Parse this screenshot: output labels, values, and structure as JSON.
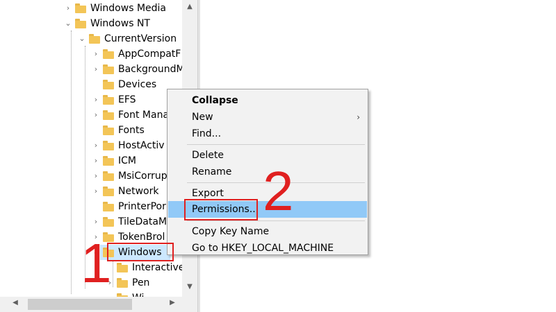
{
  "tree": {
    "nodes": [
      {
        "label": "Windows Media",
        "expander": "›"
      },
      {
        "label": "Windows NT",
        "expander": "⌄"
      },
      {
        "label": "CurrentVersion",
        "expander": "⌄"
      },
      {
        "label": "AppCompatF",
        "expander": "›"
      },
      {
        "label": "BackgroundM",
        "expander": "›"
      },
      {
        "label": "Devices",
        "expander": ""
      },
      {
        "label": "EFS",
        "expander": "›"
      },
      {
        "label": "Font Mana",
        "expander": "›"
      },
      {
        "label": "Fonts",
        "expander": ""
      },
      {
        "label": "HostActiv",
        "expander": "›"
      },
      {
        "label": "ICM",
        "expander": "›"
      },
      {
        "label": "MsiCorrup",
        "expander": "›"
      },
      {
        "label": "Network",
        "expander": "›"
      },
      {
        "label": "PrinterPor",
        "expander": ""
      },
      {
        "label": "TileDataM",
        "expander": "›"
      },
      {
        "label": "TokenBrol",
        "expander": "›"
      },
      {
        "label": "Windows",
        "expander": "⌄"
      },
      {
        "label": "Interactive",
        "expander": ""
      },
      {
        "label": "Pen",
        "expander": "›"
      },
      {
        "label": "Wi",
        "expander": ""
      }
    ]
  },
  "context_menu": {
    "collapse": "Collapse",
    "new": "New",
    "new_arrow": "›",
    "find": "Find...",
    "delete": "Delete",
    "rename": "Rename",
    "export": "Export",
    "permissions": "Permissions...",
    "copy_key_name": "Copy Key Name",
    "goto_hklm": "Go to HKEY_LOCAL_MACHINE"
  },
  "annotations": {
    "step1": "1",
    "step2": "2",
    "color": "#e02020"
  },
  "scroll": {
    "up": "▲",
    "down": "▼",
    "left": "◀",
    "right": "▶"
  }
}
